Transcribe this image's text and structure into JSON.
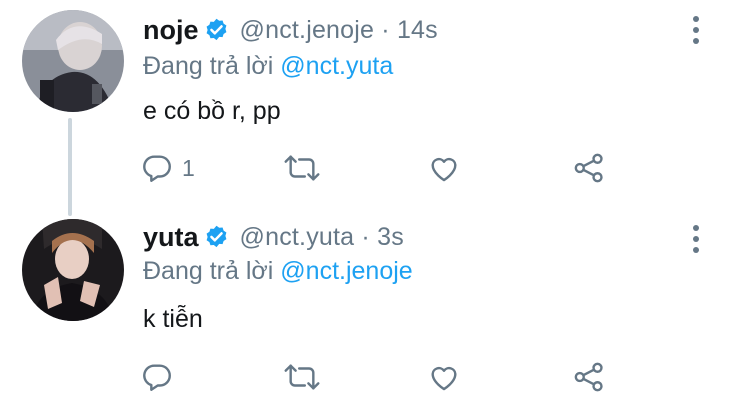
{
  "colors": {
    "accent": "#1da1f2",
    "muted": "#657786",
    "text": "#14171a",
    "thread_line": "#ccd6dd"
  },
  "tweets": [
    {
      "display_name": "noje",
      "handle": "@nct.jenoje",
      "time": "14s",
      "replying_prefix": "Đang trả lời",
      "replying_to": "@nct.yuta",
      "text": "e có bồ r, pp",
      "reply_count": "1",
      "icons": [
        "verified-badge-icon",
        "more-vertical-icon",
        "reply-icon",
        "retweet-icon",
        "like-icon",
        "share-icon"
      ]
    },
    {
      "display_name": "yuta",
      "handle": "@nct.yuta",
      "time": "3s",
      "replying_prefix": "Đang trả lời",
      "replying_to": "@nct.jenoje",
      "text": "k tiễn",
      "reply_count": "",
      "icons": [
        "verified-badge-icon",
        "more-vertical-icon",
        "reply-icon",
        "retweet-icon",
        "like-icon",
        "share-icon"
      ]
    }
  ]
}
